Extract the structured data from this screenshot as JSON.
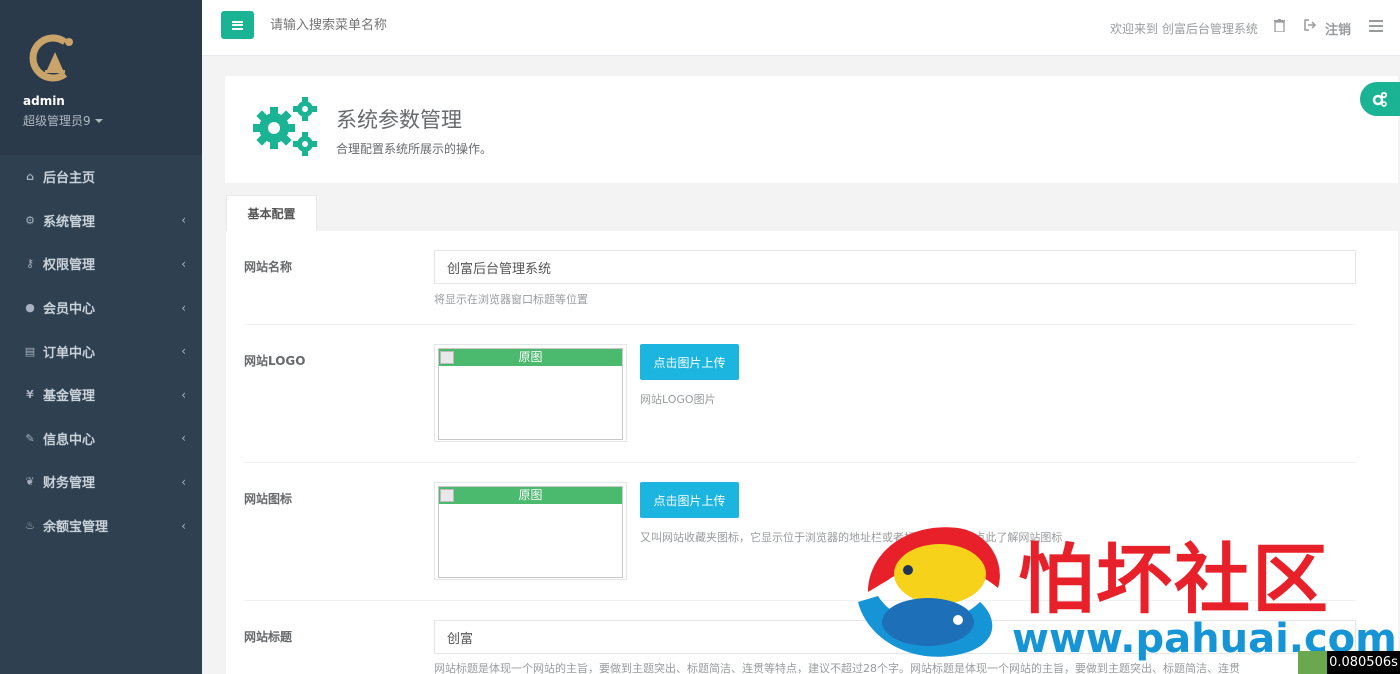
{
  "sidebar": {
    "user": {
      "name": "admin",
      "role": "超级管理员9"
    },
    "items": [
      {
        "label": "后台主页",
        "icon": "home-icon",
        "glyph": "⌂",
        "has_children": false
      },
      {
        "label": "系统管理",
        "icon": "gears-icon",
        "glyph": "⚙",
        "has_children": true
      },
      {
        "label": "权限管理",
        "icon": "key-icon",
        "glyph": "⚷",
        "has_children": true
      },
      {
        "label": "会员中心",
        "icon": "user-icon",
        "glyph": "●",
        "has_children": true
      },
      {
        "label": "订单中心",
        "icon": "list-icon",
        "glyph": "▤",
        "has_children": true
      },
      {
        "label": "基金管理",
        "icon": "yen-icon",
        "glyph": "¥",
        "has_children": true
      },
      {
        "label": "信息中心",
        "icon": "wrench-icon",
        "glyph": "✎",
        "has_children": true
      },
      {
        "label": "财务管理",
        "icon": "leaf-icon",
        "glyph": "❦",
        "has_children": true
      },
      {
        "label": "余额宝管理",
        "icon": "fire-icon",
        "glyph": "♨",
        "has_children": true
      }
    ],
    "chevron": "‹"
  },
  "topbar": {
    "search_placeholder": "请输入搜索菜单名称",
    "welcome": "欢迎来到 创富后台管理系统",
    "logout_label": "注销"
  },
  "header": {
    "title": "系统参数管理",
    "subtitle": "合理配置系统所展示的操作。"
  },
  "tabs": [
    {
      "label": "基本配置"
    }
  ],
  "form": {
    "site_name": {
      "label": "网站名称",
      "value": "创富后台管理系统",
      "help": "将显示在浏览器窗口标题等位置"
    },
    "site_logo": {
      "label": "网站LOGO",
      "thumb_label": "原图",
      "button": "点击图片上传",
      "help": "网站LOGO图片"
    },
    "site_icon": {
      "label": "网站图标",
      "thumb_label": "原图",
      "button": "点击图片上传",
      "help": "又叫网站收藏夹图标，它显示位于浏览器的地址栏或者标...ico格式，点此了解网站图标"
    },
    "site_title": {
      "label": "网站标题",
      "value": "创富",
      "help": "网站标题是体现一个网站的主旨，要做到主题突出、标题简洁、连贯等特点，建议不超过28个字。网站标题是体现一个网站的主旨，要做到主题突出、标题简洁、连贯"
    }
  },
  "watermark": {
    "title": "怕坏社区",
    "url": "www.pahuai.com"
  },
  "timer": "0.080506s",
  "colors": {
    "accent": "#1ab394",
    "sidebar": "#2f4050",
    "upload": "#1cb5e0",
    "watermark_red": "#e8202a",
    "watermark_blue": "#1594d6"
  }
}
